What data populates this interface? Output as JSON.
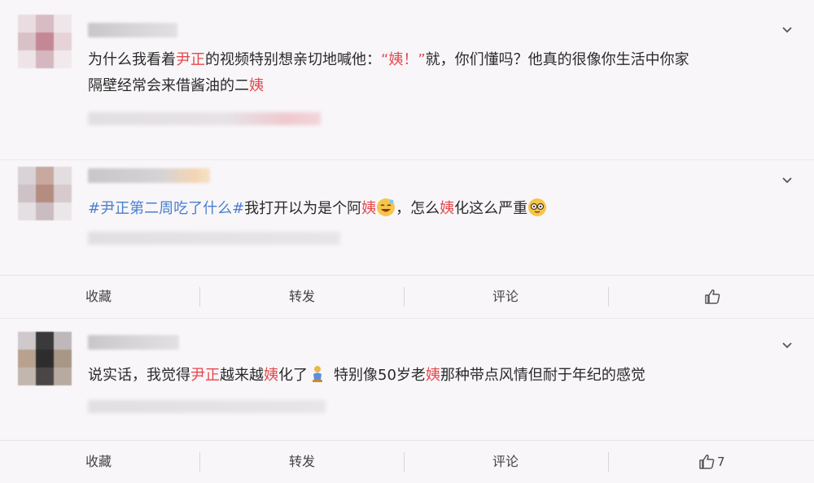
{
  "comments": [
    {
      "text_a": "为什么我看着",
      "name": "尹正",
      "text_b": "的视频特别想亲切地喊他：",
      "quote": "“姨！”",
      "text_c": "就，你们懂吗？他真的很像你生活中你家",
      "line2_a": "隔壁经常会来借酱油的二",
      "line2_b": "姨"
    },
    {
      "hashtag": "#尹正第二周吃了什么#",
      "text_a": "我打开以为是个阿",
      "hl1": "姨",
      "text_b": "，怎么",
      "hl2": "姨",
      "text_c": "化这么严重",
      "emoji1": "laughing-face-emoji",
      "emoji2": "glasses-face-emoji"
    },
    {
      "text_a": "说实话，我觉得",
      "name": "尹正",
      "text_b": "越来越",
      "hl1": "姨",
      "text_c": "化了",
      "text_d": "特别像50岁老",
      "hl2": "姨",
      "text_e": "那种带点风情但耐于年纪的感觉",
      "emoji": "person-kneeling-emoji"
    }
  ],
  "actions": {
    "favorite": "收藏",
    "repost": "转发",
    "comment": "评论",
    "like_count": "7"
  },
  "colors": {
    "highlight": "#e3494e",
    "hashtag": "#4a7fd0"
  }
}
